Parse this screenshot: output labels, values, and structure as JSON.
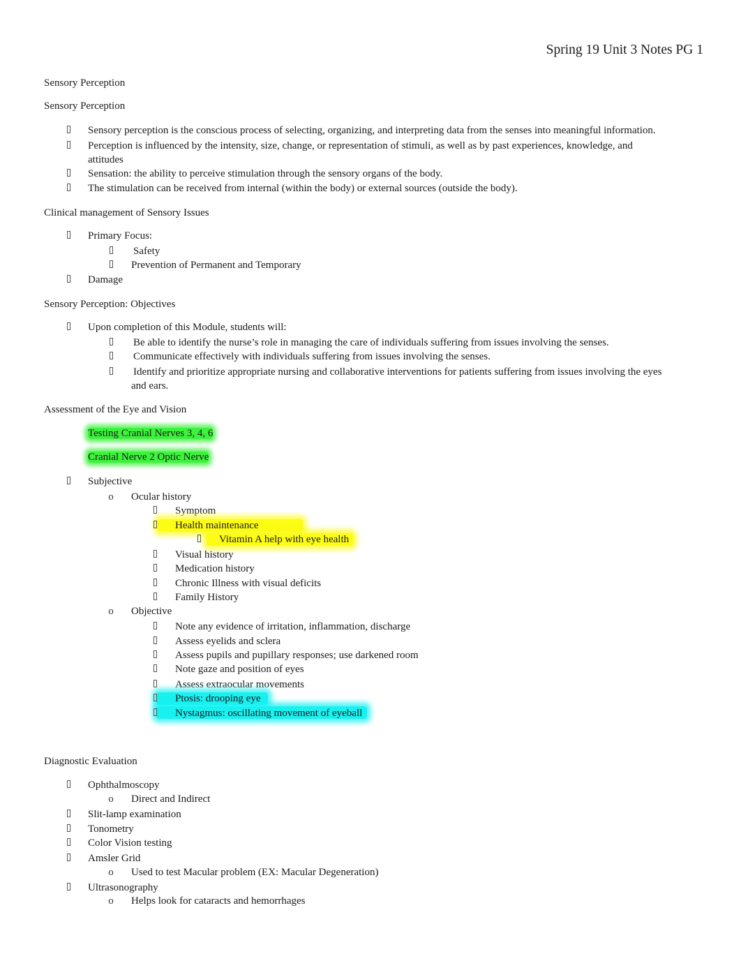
{
  "header": {
    "title": "Spring 19 Unit 3 Notes PG 1"
  },
  "sections": {
    "s1": {
      "heading1": "Sensory Perception",
      "heading2": "Sensory Perception",
      "items": [
        "Sensory perception is the conscious process of selecting, organizing, and interpreting data from the senses into meaningful information.",
        "Perception is influenced by the intensity, size, change, or representation of stimuli, as well as by past experiences, knowledge, and",
        "attitudes",
        "Sensation: the ability to perceive stimulation through the sensory organs of the body.",
        "The stimulation can be received from internal (within the body) or external sources (outside the body)."
      ]
    },
    "s2": {
      "heading": "Clinical management of Sensory Issues",
      "items": [
        "Primary Focus:",
        "Safety",
        "Prevention of Permanent and Temporary",
        "Damage"
      ]
    },
    "s3": {
      "heading": "Sensory Perception: Objectives",
      "items": [
        "Upon completion of this Module, students will:",
        "Be able to identify the nurse’s role in managing the care of individuals suffering from issues involving the senses.",
        "Communicate effectively with individuals suffering from issues involving the senses.",
        "Identify and prioritize appropriate nursing and collaborative interventions for patients suffering from issues involving the eyes",
        "and ears."
      ]
    },
    "s4": {
      "heading": "Assessment of the Eye and Vision",
      "highlights": [
        "Testing Cranial Nerves 3, 4, 6",
        "Cranial Nerve 2 Optic Nerve"
      ],
      "subjective": "Subjective",
      "ocular_history": "Ocular history",
      "ocular_items": [
        "Symptom",
        "Health maintenance",
        "Vitamin A help with eye health",
        "Visual history",
        "Medication history",
        "Chronic Illness with visual deficits",
        "Family History"
      ],
      "objective": "Objective",
      "objective_items": [
        "Note any evidence of irritation, inflammation, discharge",
        "Assess eyelids and sclera",
        "Assess pupils and pupillary responses; use darkened room",
        "Note gaze and position of eyes",
        "Assess extraocular movements",
        "Ptosis: drooping eye",
        "Nystagmus: oscillating movement of eyeball"
      ]
    },
    "s5": {
      "heading": "Diagnostic Evaluation",
      "items": [
        "Ophthalmoscopy",
        "Direct and Indirect",
        "Slit-lamp examination",
        "Tonometry",
        "Color Vision testing",
        "Amsler Grid",
        "Used to test Macular problem (EX: Macular Degeneration)",
        "Ultrasonography",
        "Helps look for cataracts and hemorrhages"
      ]
    }
  },
  "glyphs": {
    "circle_bullet": "o"
  },
  "highlight_colors": {
    "green": "#3df23d",
    "yellow": "#fcfc14",
    "cyan": "#19f0f0"
  }
}
